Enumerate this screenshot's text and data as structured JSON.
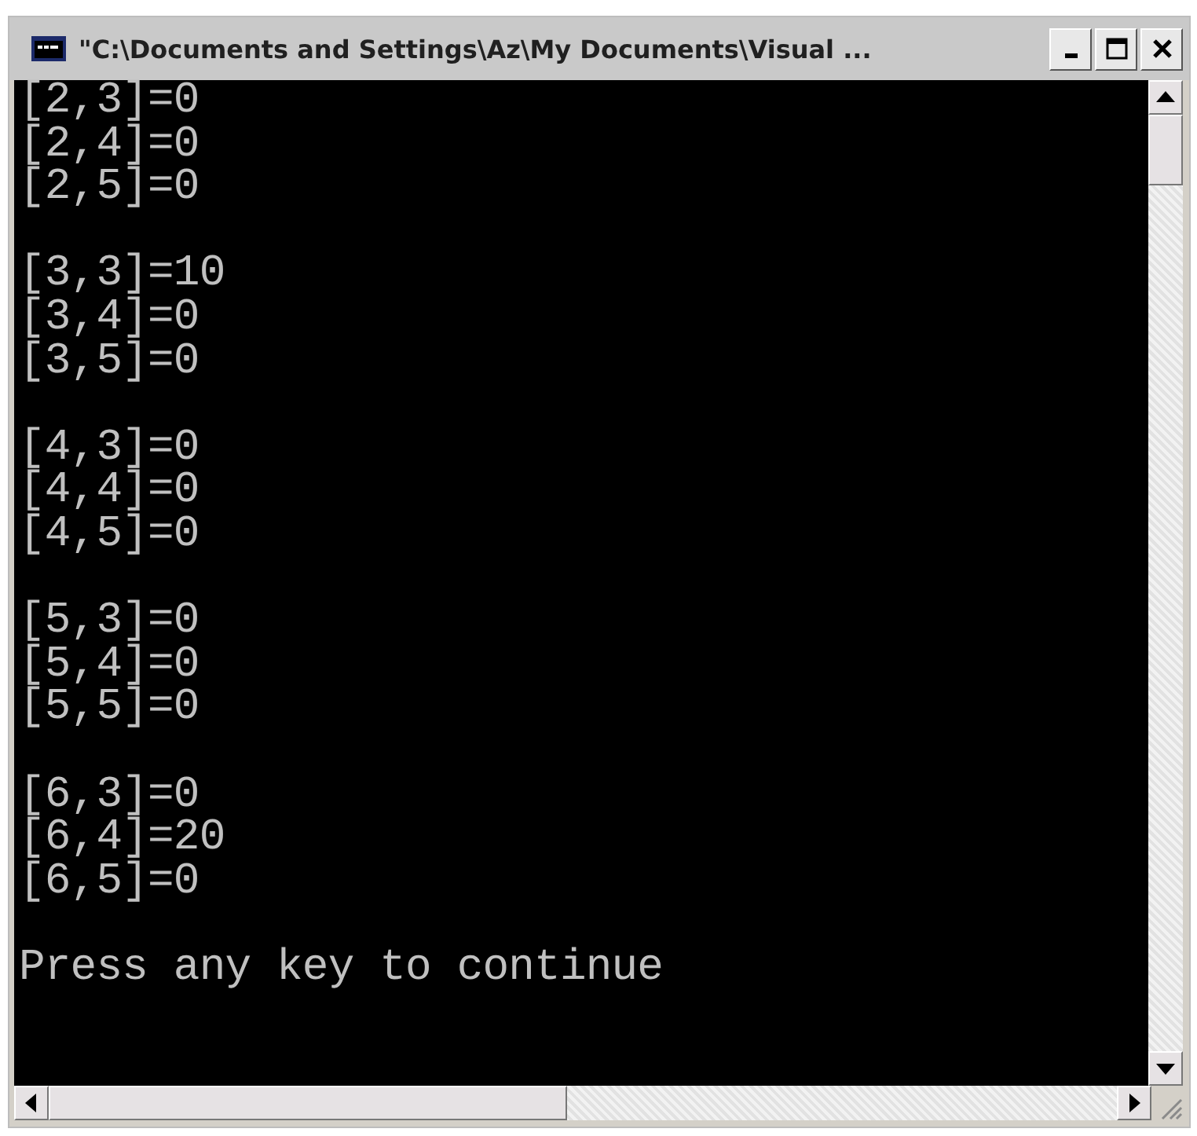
{
  "window": {
    "title": "\"C:\\Documents and Settings\\Az\\My Documents\\Visual ..."
  },
  "console": {
    "groups": [
      [
        "[2,3]=0",
        "[2,4]=0",
        "[2,5]=0"
      ],
      [
        "[3,3]=10",
        "[3,4]=0",
        "[3,5]=0"
      ],
      [
        "[4,3]=0",
        "[4,4]=0",
        "[4,5]=0"
      ],
      [
        "[5,3]=0",
        "[5,4]=0",
        "[5,5]=0"
      ],
      [
        "[6,3]=0",
        "[6,4]=20",
        "[6,5]=0"
      ]
    ],
    "prompt": "Press any key to continue"
  }
}
